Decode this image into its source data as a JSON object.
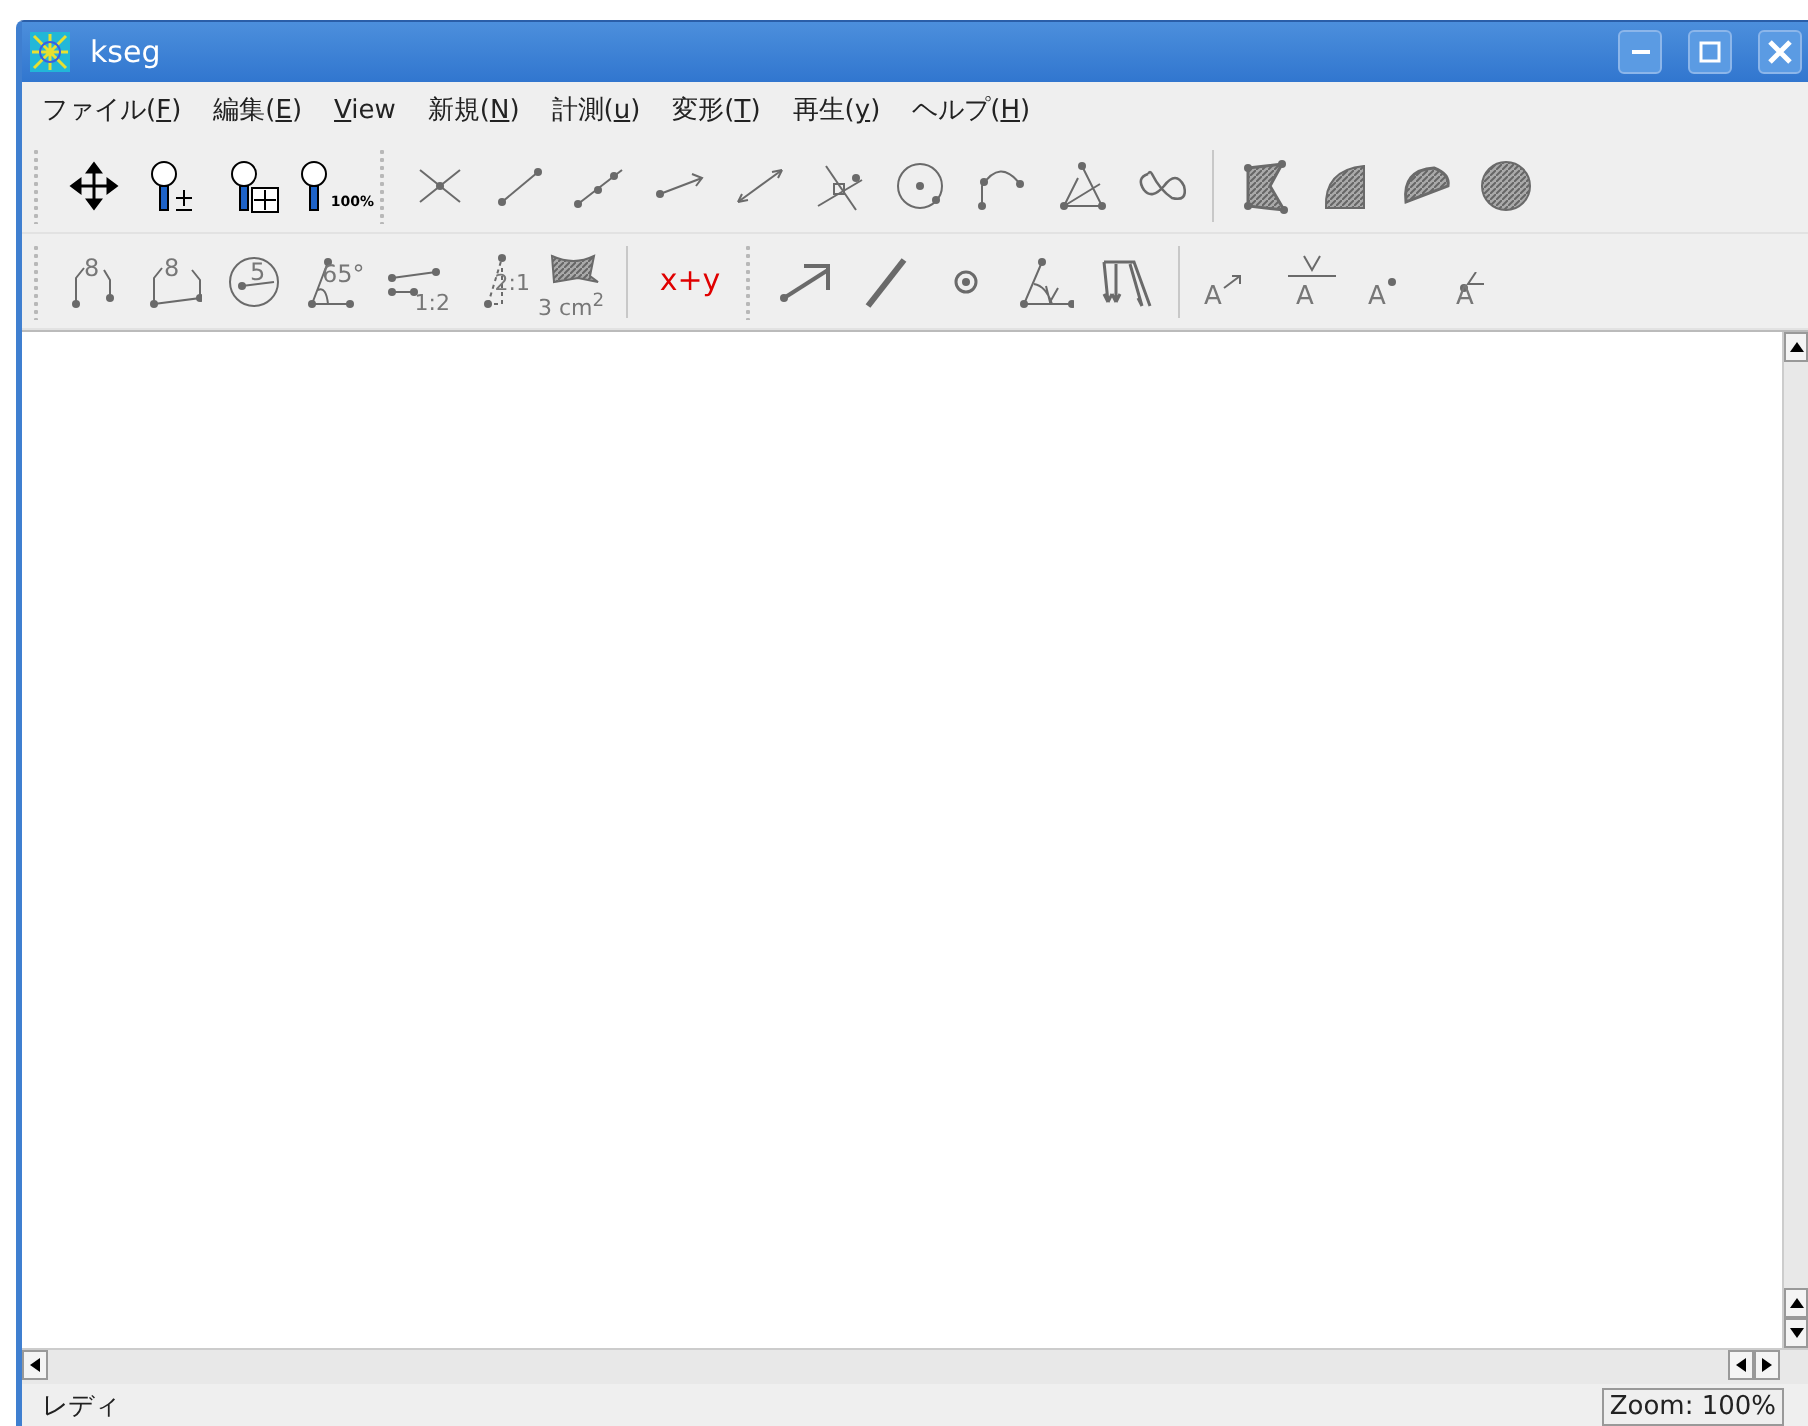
{
  "window": {
    "title": "kseg"
  },
  "menu": [
    {
      "pre": "ファイル(",
      "key": "F",
      "post": ")"
    },
    {
      "pre": "編集(",
      "key": "E",
      "post": ")"
    },
    {
      "key": "V",
      "post": "iew"
    },
    {
      "pre": "新規(",
      "key": "N",
      "post": ")"
    },
    {
      "pre": "計測(",
      "key": "u",
      "post": ")"
    },
    {
      "pre": "変形(",
      "key": "T",
      "post": ")"
    },
    {
      "pre": "再生(",
      "key": "y",
      "post": ")"
    },
    {
      "pre": "ヘルプ(",
      "key": "H",
      "post": ")"
    }
  ],
  "toolbars": [
    [
      {
        "kind": "grip"
      },
      {
        "kind": "move"
      },
      {
        "kind": "zoom"
      },
      {
        "kind": "zoomfit"
      },
      {
        "kind": "zoom100",
        "label": "100%"
      },
      {
        "kind": "grip"
      },
      {
        "kind": "intersect"
      },
      {
        "kind": "segment"
      },
      {
        "kind": "ray"
      },
      {
        "kind": "arrow"
      },
      {
        "kind": "line"
      },
      {
        "kind": "perpendicular"
      },
      {
        "kind": "circle"
      },
      {
        "kind": "arc"
      },
      {
        "kind": "bisector"
      },
      {
        "kind": "locus"
      },
      {
        "kind": "sep"
      },
      {
        "kind": "polygon"
      },
      {
        "kind": "sector"
      },
      {
        "kind": "segmentfill"
      },
      {
        "kind": "disk"
      }
    ],
    [
      {
        "kind": "grip"
      },
      {
        "kind": "arclength",
        "label": "8"
      },
      {
        "kind": "perimeter",
        "label": "8"
      },
      {
        "kind": "radius",
        "label": "5"
      },
      {
        "kind": "angle",
        "label": "65°"
      },
      {
        "kind": "ratio",
        "label": "1:2"
      },
      {
        "kind": "ratio2",
        "label": "2:1"
      },
      {
        "kind": "area",
        "label": "3 cm$^{2}$"
      },
      {
        "kind": "sep"
      },
      {
        "kind": "calc",
        "label": "x+y"
      },
      {
        "kind": "grip"
      },
      {
        "kind": "translate"
      },
      {
        "kind": "thickline"
      },
      {
        "kind": "center"
      },
      {
        "kind": "rotate"
      },
      {
        "kind": "reflect"
      },
      {
        "kind": "sep"
      },
      {
        "kind": "label1",
        "label": "A"
      },
      {
        "kind": "label2",
        "label": "A"
      },
      {
        "kind": "label3",
        "label": "A"
      },
      {
        "kind": "label4",
        "label": "A"
      }
    ]
  ],
  "status": {
    "message": "レディ",
    "zoom": "Zoom: 100%"
  }
}
